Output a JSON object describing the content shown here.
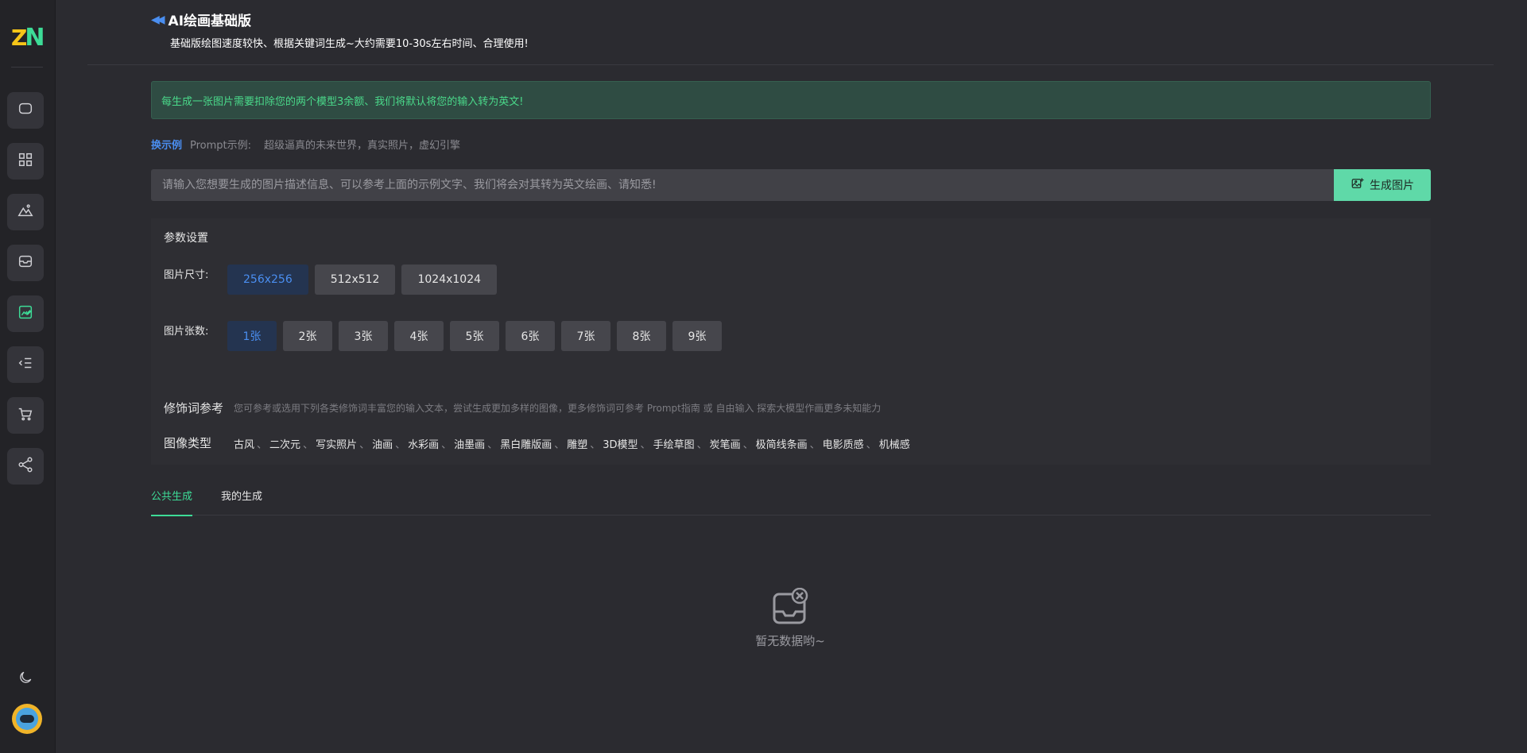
{
  "sidebar": {
    "logo": {
      "z": "Z",
      "n": "N"
    },
    "items": [
      {
        "name": "chat-icon"
      },
      {
        "name": "apps-grid-icon"
      },
      {
        "name": "image-mountain-icon"
      },
      {
        "name": "inbox-icon"
      },
      {
        "name": "edit-image-icon"
      },
      {
        "name": "list-collapse-icon"
      },
      {
        "name": "cart-icon"
      },
      {
        "name": "share-icon"
      }
    ],
    "theme_icon": "moon-icon"
  },
  "header": {
    "title": "AI绘画基础版",
    "subtitle": "基础版绘图速度较快、根据关键词生成~大约需要10-30s左右时间、合理使用!"
  },
  "notice": {
    "text": "每生成一张图片需要扣除您的两个模型3余额、我们将默认将您的输入转为英文!"
  },
  "example": {
    "swap_label": "换示例",
    "prompt_label": "Prompt示例:",
    "prompt_text": "超级逼真的未来世界，真实照片，虚幻引擎"
  },
  "prompt": {
    "placeholder": "请输入您想要生成的图片描述信息、可以参考上面的示例文字、我们将会对其转为英文绘画、请知悉!",
    "value": "",
    "generate_label": "生成图片"
  },
  "params": {
    "title": "参数设置",
    "size_label": "图片尺寸:",
    "sizes": [
      "256x256",
      "512x512",
      "1024x1024"
    ],
    "selected_size": "256x256",
    "count_label": "图片张数:",
    "counts": [
      "1张",
      "2张",
      "3张",
      "4张",
      "5张",
      "6张",
      "7张",
      "8张",
      "9张"
    ],
    "selected_count": "1张",
    "modifier_title": "修饰词参考",
    "modifier_desc": "您可参考或选用下列各类修饰词丰富您的输入文本，尝试生成更加多样的图像，更多修饰词可参考 Prompt指南 或 自由输入 探索大模型作画更多未知能力",
    "type_title": "图像类型",
    "types": [
      "古风",
      "二次元",
      "写实照片",
      "油画",
      "水彩画",
      "油墨画",
      "黑白雕版画",
      "雕塑",
      "3D模型",
      "手绘草图",
      "炭笔画",
      "极简线条画",
      "电影质感",
      "机械感"
    ],
    "type_separator": "、"
  },
  "tabs": {
    "items": [
      "公共生成",
      "我的生成"
    ],
    "active": "公共生成"
  },
  "empty": {
    "text": "暂无数据哟~"
  },
  "colors": {
    "accent_green": "#3ddc97",
    "accent_blue": "#4a8ef0",
    "background": "#2b2b30",
    "sidebar": "#232327"
  }
}
